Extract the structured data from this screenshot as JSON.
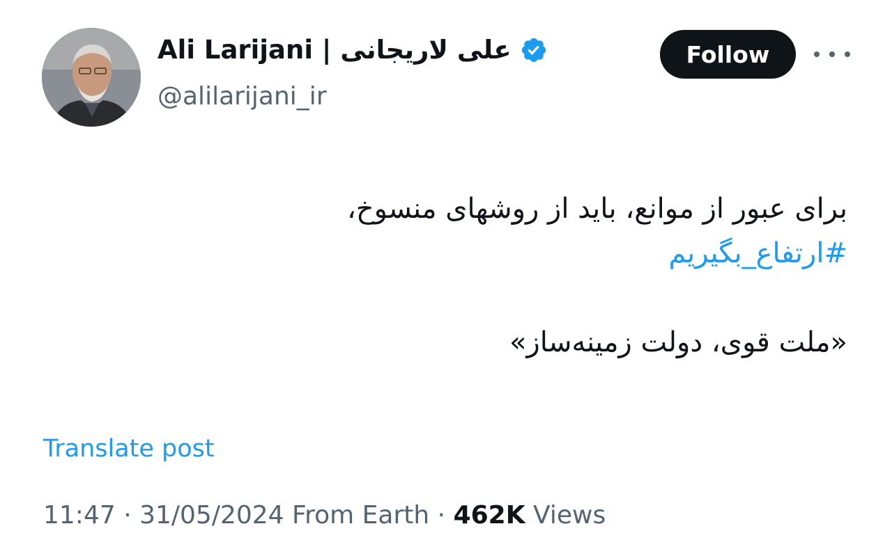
{
  "author": {
    "display_name": "Ali Larijani | علی لاریجانی",
    "handle": "@alilarijani_ir",
    "verified_icon": "verified-badge-icon"
  },
  "actions": {
    "follow_label": "Follow",
    "more_icon": "more-horizontal-icon"
  },
  "tweet": {
    "line_1": "برای عبور از موانع، باید از روشهای منسوخ،",
    "hashtag": "#ارتفاع_بگیریم",
    "line_3": "«ملت قوی، دولت زمینه‌ساز»"
  },
  "translate_label": "Translate post",
  "meta": {
    "time": "11:47",
    "separator_1": " · ",
    "date": "31/05/2024",
    "source": " From Earth",
    "separator_2": " · ",
    "views_count": "462K",
    "views_label": " Views"
  },
  "colors": {
    "accent": "#1d9bf0",
    "text_primary": "#0f1419",
    "text_secondary": "#536471",
    "button_bg": "#0f1419"
  }
}
